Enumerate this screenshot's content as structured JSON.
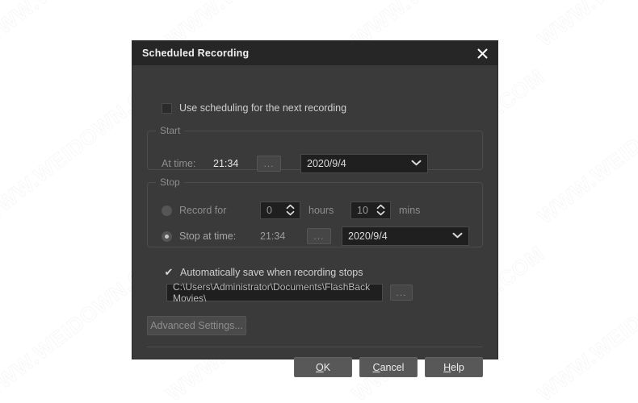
{
  "watermark": {
    "text": "WWW.WEIDOWN.COM",
    "color": "#f2f2f2"
  },
  "dialog": {
    "title": "Scheduled Recording",
    "close_icon": "close-icon",
    "use_scheduling": {
      "label": "Use scheduling for the next recording",
      "checked": false
    },
    "start_group": {
      "legend": "Start",
      "at_time_label": "At time:",
      "at_time_value": "21:34",
      "browse_label": "...",
      "date_value": "2020/9/4",
      "caret_icon": "chevron-down-icon"
    },
    "stop_group": {
      "legend": "Stop",
      "record_for": {
        "label": "Record for",
        "selected": false,
        "hours_value": "0",
        "hours_label": "hours",
        "mins_value": "10",
        "mins_label": "mins",
        "spinner_up_icon": "chevron-up-icon",
        "spinner_down_icon": "chevron-down-icon"
      },
      "stop_at_time": {
        "label": "Stop at time:",
        "selected": true,
        "time_value": "21:34",
        "browse_label": "...",
        "date_value": "2020/9/4",
        "caret_icon": "chevron-down-icon"
      }
    },
    "autosave": {
      "label": "Automatically save when recording stops",
      "checked": true,
      "check_glyph": "✔",
      "path_value": "C:\\Users\\Administrator\\Documents\\FlashBack Movies\\",
      "browse_label": "..."
    },
    "advanced_settings_label": "Advanced Settings...",
    "footer": {
      "ok": {
        "prefix": "",
        "mnemonic": "O",
        "suffix": "K"
      },
      "cancel": {
        "prefix": "",
        "mnemonic": "C",
        "suffix": "ancel"
      },
      "help": {
        "prefix": "",
        "mnemonic": "H",
        "suffix": "elp"
      }
    }
  }
}
